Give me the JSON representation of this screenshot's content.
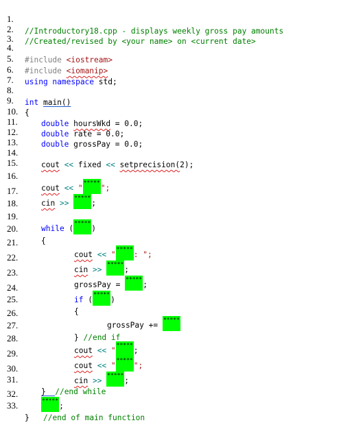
{
  "document": {
    "lines": [
      {
        "n": "1.",
        "text": "//Introductory18.cpp - displays weekly gross pay amounts"
      },
      {
        "n": "2.",
        "text": "//Created/revised by <your name> on <current date>"
      },
      {
        "n": "3.",
        "text": ""
      },
      {
        "n": "4.",
        "pre": "#include ",
        "str": "<iostream>"
      },
      {
        "n": "5.",
        "pre": "#include ",
        "str": "<iomanip>"
      },
      {
        "n": "6.",
        "kw": "using namespace",
        "rest": " std;"
      },
      {
        "n": "7.",
        "text": ""
      },
      {
        "n": "8.",
        "kw": "int",
        "rest": "main()"
      },
      {
        "n": "9.",
        "rest": "{"
      },
      {
        "n": "10.",
        "kw": "double",
        "var": "hoursWkd",
        "rest": " = 0.0;"
      },
      {
        "n": "11.",
        "kw": "double",
        "rest": " rate = 0.0;"
      },
      {
        "n": "12.",
        "kw": "double",
        "rest": " grossPay = 0.0;"
      },
      {
        "n": "13.",
        "text": ""
      },
      {
        "n": "14.",
        "a": "cout",
        "op1": " << ",
        "b": "fixed",
        "op2": " << ",
        "c": "setprecision(",
        "d": "2);"
      },
      {
        "n": "15.",
        "text": ""
      },
      {
        "n": "16.",
        "a": "cout",
        "op": " << ",
        "q": "\"",
        "blank": "*****",
        "end": "\";"
      },
      {
        "n": "17.",
        "a": "cin",
        "op": " >> ",
        "blank": "*****",
        "end": ";"
      },
      {
        "n": "18.",
        "text": ""
      },
      {
        "n": "19.",
        "kw": "while",
        "rest": " (",
        "blank": "*****",
        "end": ")"
      },
      {
        "n": "20.",
        "rest": "{"
      },
      {
        "n": "21.",
        "a": "cout",
        "op": " << ",
        "q": "\"",
        "blank": "*****",
        "end": ": \";"
      },
      {
        "n": "22.",
        "a": "cin",
        "op": " >> ",
        "blank": "*****",
        "end": ";"
      },
      {
        "n": "23.",
        "rest": "grossPay = ",
        "blank": "*****",
        "end": ";"
      },
      {
        "n": "24.",
        "kw": "if",
        "rest": " (",
        "blank": "*****",
        "end": ")"
      },
      {
        "n": "25.",
        "rest": "{"
      },
      {
        "n": "26.",
        "rest": "grossPay += ",
        "blank": "*****"
      },
      {
        "n": "27.",
        "rest": "} ",
        "cm": "//end if"
      },
      {
        "n": "28.",
        "a": "cout",
        "op": " << ",
        "q": "\"",
        "blank": "*****",
        "end": ";"
      },
      {
        "n": "29.",
        "a": "cout",
        "op": " << ",
        "q": "\"",
        "blank": "*****",
        "end": "\";"
      },
      {
        "n": "30.",
        "a": "cin",
        "op": " >> ",
        "blank": "*****",
        "end": ";"
      },
      {
        "n": "31.",
        "rest": "}  ",
        "cm": "//end while"
      },
      {
        "n": "32.",
        "blank": "*****",
        "end": ";"
      },
      {
        "n": "33.",
        "rest": "}",
        "cm": "//end of main function"
      }
    ]
  },
  "colors": {
    "comment": "#008000",
    "keyword": "#0000ff",
    "preprocessor": "#808080",
    "string": "#a31515",
    "operator": "#008080",
    "highlight": "#00ff00"
  }
}
